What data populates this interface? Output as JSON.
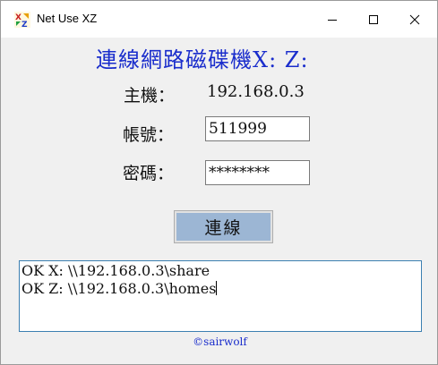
{
  "window": {
    "title": "Net Use XZ",
    "controls": [
      "minimize",
      "maximize",
      "close"
    ]
  },
  "form": {
    "heading": "連線網路磁碟機X: Z:",
    "host_label": "主機：",
    "host_value": "192.168.0.3",
    "account_label": "帳號：",
    "account_value": "511999",
    "password_label": "密碼：",
    "password_value": "********",
    "connect_label": "連線"
  },
  "log": {
    "lines": [
      "OK X: \\\\192.168.0.3\\share",
      "OK Z: \\\\192.168.0.3\\homes"
    ]
  },
  "footer": {
    "credit": "©sairwolf"
  },
  "colors": {
    "heading": "#1a2dcc",
    "button_fill": "#9cb6d4",
    "window_bg": "#f0f0f0",
    "log_border": "#3c7fb1"
  }
}
